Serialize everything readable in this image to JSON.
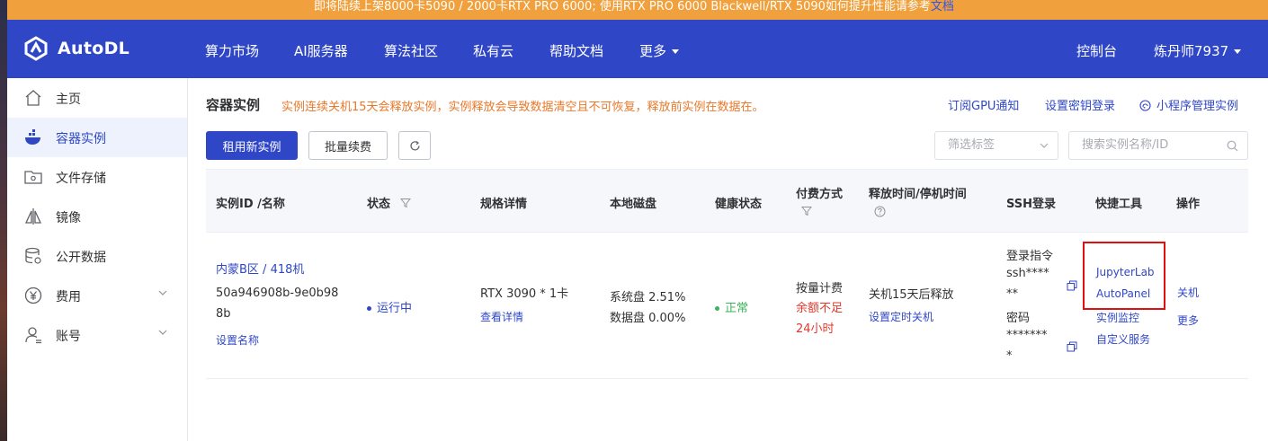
{
  "banner": {
    "text": "即将陆续上架8000卡5090 / 2000卡RTX PRO 6000; 使用RTX PRO 6000 Blackwell/RTX 5090如何提升性能请参考",
    "link": "文档"
  },
  "nav": {
    "brand": "AutoDL",
    "items": [
      "算力市场",
      "AI服务器",
      "算法社区",
      "私有云",
      "帮助文档",
      "更多"
    ],
    "console": "控制台",
    "user": "炼丹师7937"
  },
  "sidebar": {
    "items": [
      {
        "label": "主页",
        "icon": "home-icon"
      },
      {
        "label": "容器实例",
        "icon": "container-icon"
      },
      {
        "label": "文件存储",
        "icon": "folder-icon"
      },
      {
        "label": "镜像",
        "icon": "mirror-icon"
      },
      {
        "label": "公开数据",
        "icon": "database-icon"
      },
      {
        "label": "费用",
        "icon": "yen-icon"
      },
      {
        "label": "账号",
        "icon": "user-icon"
      }
    ]
  },
  "main": {
    "title": "容器实例",
    "notice": "实例连续关机15天会释放实例，实例释放会导致数据清空且不可恢复，释放前实例在数据在。",
    "links": [
      "订阅GPU通知",
      "设置密钥登录",
      "小程序管理实例"
    ],
    "buttons": {
      "rent": "租用新实例",
      "renew": "批量续费"
    },
    "filter_placeholder": "筛选标签",
    "search_placeholder": "搜索实例名称/ID"
  },
  "table": {
    "headers": {
      "id": "实例ID /名称",
      "status": "状态",
      "spec": "规格详情",
      "disk": "本地磁盘",
      "health": "健康状态",
      "billing_l1": "付费方式",
      "release": "释放时间/停机时间",
      "ssh": "SSH登录",
      "tools": "快捷工具",
      "ops": "操作"
    },
    "row": {
      "region": "内蒙B区 / 418机",
      "id_line1": "50a946908b-9e0b98",
      "id_line2": "8b",
      "set_name": "设置名称",
      "status": "运行中",
      "spec": "RTX 3090 * 1卡",
      "spec_link": "查看详情",
      "disk_sys": "系统盘 2.51%",
      "disk_data": "数据盘 0.00%",
      "health": "正常",
      "billing": "按量计费",
      "billing_warn_1": "余额不足",
      "billing_warn_2": "24小时",
      "release": "关机15天后释放",
      "release_link": "设置定时关机",
      "ssh_cmd_label": "登录指令",
      "ssh_cmd_1": "ssh****",
      "ssh_cmd_2": "**",
      "ssh_pwd_label": "密码",
      "ssh_pwd_1": "*******",
      "ssh_pwd_2": "*",
      "tools": [
        "JupyterLab",
        "AutoPanel",
        "实例监控",
        "自定义服务"
      ],
      "ops": [
        "关机",
        "更多"
      ]
    }
  },
  "colors": {
    "primary": "#2f47c7",
    "banner": "#f0a03c",
    "warning": "#e6792b",
    "danger": "#e03a2f",
    "success": "#3db35a"
  }
}
